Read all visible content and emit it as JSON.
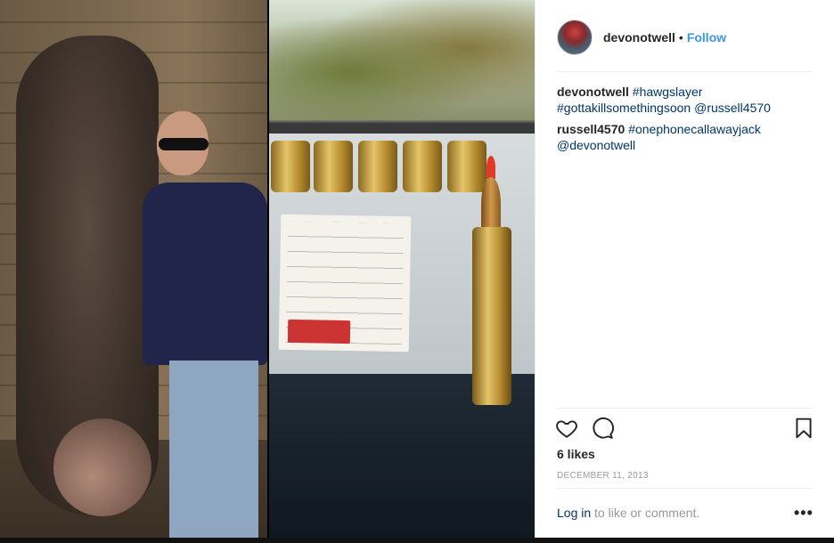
{
  "post": {
    "author": "devonotwell",
    "separator": "•",
    "follow_label": "Follow"
  },
  "comments": [
    {
      "author": "devonotwell",
      "parts": [
        "#hawgslayer",
        "#gottakillsomethingsoon",
        "@russell4570"
      ]
    },
    {
      "author": "russell4570",
      "parts": [
        "#onephonecallawayjack",
        "@devonotwell"
      ]
    }
  ],
  "likes": "6 likes",
  "date": "DECEMBER 11, 2013",
  "login": {
    "link": "Log in",
    "suffix": " to like or comment."
  },
  "more_label": "•••",
  "icons": {
    "like": "heart-icon",
    "comment": "comment-icon",
    "save": "bookmark-icon"
  }
}
